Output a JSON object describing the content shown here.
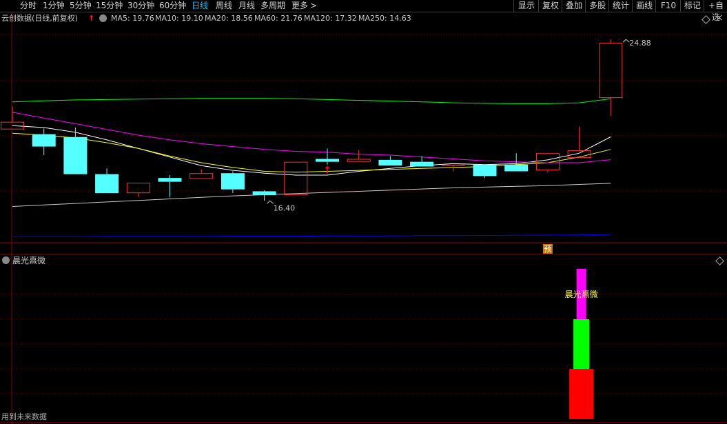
{
  "toolbar": {
    "periods": [
      "分时",
      "1分钟",
      "5分钟",
      "15分钟",
      "30分钟",
      "60分钟",
      "日线",
      "周线",
      "月线",
      "多周期",
      "更多"
    ],
    "active_period": "日线",
    "more_arrow": ">",
    "right_buttons": [
      "显示",
      "复权",
      "叠加",
      "多股",
      "统计",
      "画线",
      "F10",
      "标记",
      "+自选"
    ]
  },
  "chart": {
    "title": "云创数据(日线,前复权)",
    "up_arrow_glyph": "↑",
    "ma_items": [
      {
        "label": "MA5: 19.76",
        "color": "#ffffff"
      },
      {
        "label": "MA10: 19.10",
        "color": "#ffff00"
      },
      {
        "label": "MA20: 18.56",
        "color": "#ff00ff"
      },
      {
        "label": "MA60: 21.76",
        "color": "#00ff00"
      },
      {
        "label": "MA120: 17.32",
        "color": "#c8c8c8"
      },
      {
        "label": "MA250: 14.63",
        "color": "#0000ff"
      }
    ],
    "high_label": "24.88",
    "low_label": "16.40",
    "forecast_badge": "预",
    "close_icon": "×"
  },
  "indicator": {
    "title": "晨光熹微",
    "signal_label": "晨光熹微",
    "bars": [
      {
        "color": "#ff00ff",
        "segment": "top"
      },
      {
        "color": "#00ff00",
        "segment": "middle"
      },
      {
        "color": "#ff0000",
        "segment": "bottom"
      }
    ]
  },
  "footer": {
    "note": "用到未来数据"
  },
  "chart_data": {
    "type": "candlestick",
    "candles": [
      {
        "open": 20.15,
        "close": 20.55,
        "high": 21.35,
        "low": null
      },
      {
        "open": 19.9,
        "close": 19.25,
        "high": 20.2,
        "low": 18.8
      },
      {
        "open": 19.75,
        "close": 17.8,
        "high": 20.25,
        "low": null
      },
      {
        "open": 17.8,
        "close": 16.8,
        "high": 18.1,
        "low": null
      },
      {
        "open": 16.8,
        "close": 17.35,
        "high": 17.35,
        "low": 16.6
      },
      {
        "open": 17.6,
        "close": 17.4,
        "high": 17.75,
        "low": 16.6
      },
      {
        "open": 17.55,
        "close": 17.85,
        "high": 18.05,
        "low": null
      },
      {
        "open": 17.85,
        "close": 17.0,
        "high": 17.95,
        "low": 16.8
      },
      {
        "open": 16.9,
        "close": 16.7,
        "high": 16.95,
        "low": 16.4
      },
      {
        "open": 16.7,
        "close": 18.45,
        "high": null,
        "low": null
      },
      {
        "open": 18.6,
        "close": 18.45,
        "high": 19.15,
        "low": 18.3
      },
      {
        "open": 18.45,
        "close": 18.6,
        "high": 19.05,
        "low": null
      },
      {
        "open": 18.55,
        "close": 18.25,
        "high": 18.75,
        "low": null
      },
      {
        "open": 18.45,
        "close": 18.2,
        "high": 18.75,
        "low": null
      },
      {
        "open": 18.3,
        "close": 18.3,
        "high": null,
        "low": 17.95
      },
      {
        "open": 18.3,
        "close": 17.7,
        "high": 18.3,
        "low": 17.6
      },
      {
        "open": 18.3,
        "close": 17.95,
        "high": 18.9,
        "low": null
      },
      {
        "open": 18.0,
        "close": 18.9,
        "high": null,
        "low": 17.9
      },
      {
        "open": 18.65,
        "close": 19.05,
        "high": 20.3,
        "low": null
      },
      {
        "open": 21.8,
        "close": 24.7,
        "high": 24.88,
        "low": 20.85
      }
    ],
    "ma_series": [
      {
        "name": "MA5",
        "color": "#ffffff",
        "values": [
          20.35,
          20.25,
          20.0,
          19.6,
          19.15,
          18.7,
          18.25,
          18.0,
          17.85,
          17.75,
          17.75,
          17.95,
          18.1,
          18.25,
          18.35,
          18.3,
          18.35,
          18.55,
          18.9,
          19.76
        ]
      },
      {
        "name": "MA10",
        "color": "#ffff00",
        "values": [
          19.95,
          19.85,
          19.7,
          19.45,
          19.15,
          18.75,
          18.4,
          18.15,
          17.95,
          17.9,
          17.95,
          18.0,
          18.05,
          18.1,
          18.15,
          18.2,
          18.3,
          18.4,
          18.7,
          19.1
        ]
      },
      {
        "name": "MA20",
        "color": "#ff00ff",
        "values": [
          21.05,
          20.75,
          20.45,
          20.15,
          19.85,
          19.6,
          19.4,
          19.25,
          19.1,
          19.0,
          18.95,
          18.85,
          18.8,
          18.7,
          18.6,
          18.5,
          18.45,
          18.4,
          18.4,
          18.56
        ]
      },
      {
        "name": "MA60",
        "color": "#00ff00",
        "values": [
          21.6,
          21.65,
          21.7,
          21.72,
          21.74,
          21.76,
          21.78,
          21.78,
          21.78,
          21.76,
          21.72,
          21.68,
          21.64,
          21.6,
          21.55,
          21.52,
          21.5,
          21.5,
          21.55,
          21.76
        ]
      },
      {
        "name": "MA120",
        "color": "#c8c8c8",
        "values": [
          16.1,
          16.18,
          16.26,
          16.34,
          16.42,
          16.5,
          16.58,
          16.66,
          16.72,
          16.78,
          16.84,
          16.9,
          16.96,
          17.02,
          17.08,
          17.12,
          17.16,
          17.2,
          17.26,
          17.32
        ]
      },
      {
        "name": "MA250",
        "color": "#0000ff",
        "values": [
          14.52,
          14.52,
          14.52,
          14.53,
          14.53,
          14.53,
          14.53,
          14.54,
          14.54,
          14.54,
          14.55,
          14.55,
          14.56,
          14.57,
          14.57,
          14.58,
          14.59,
          14.6,
          14.61,
          14.63
        ]
      }
    ],
    "ylim": [
      14.2,
      25.5
    ]
  }
}
